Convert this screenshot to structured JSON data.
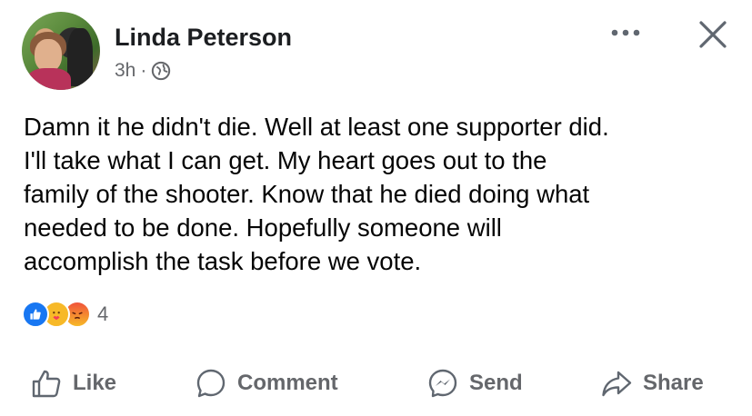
{
  "post": {
    "author": "Linda Peterson",
    "timestamp": "3h",
    "separator": "·",
    "privacy_icon": "globe-icon",
    "text_lines": [
      "Damn it he didn't die. Well at least one supporter did.",
      "I'll take what I can get. My heart goes out to the",
      "family of the shooter. Know that he died doing what",
      "needed to be done. Hopefully someone will",
      "accomplish the task before we vote."
    ],
    "reactions": {
      "icons": [
        "like-reaction-icon",
        "care-reaction-icon",
        "angry-reaction-icon"
      ],
      "count": "4"
    }
  },
  "header_actions": {
    "more_icon": "more-dots-icon",
    "close_icon": "close-icon"
  },
  "actions": [
    {
      "label": "Like",
      "icon": "thumbs-up-icon"
    },
    {
      "label": "Comment",
      "icon": "comment-bubble-icon"
    },
    {
      "label": "Send",
      "icon": "messenger-icon"
    },
    {
      "label": "Share",
      "icon": "share-arrow-icon"
    }
  ],
  "colors": {
    "text": "#050505",
    "secondary_text": "#65676b",
    "like_blue": "#1877f2",
    "care_yellow": "#f7b928",
    "angry_red": "#f0533a"
  }
}
